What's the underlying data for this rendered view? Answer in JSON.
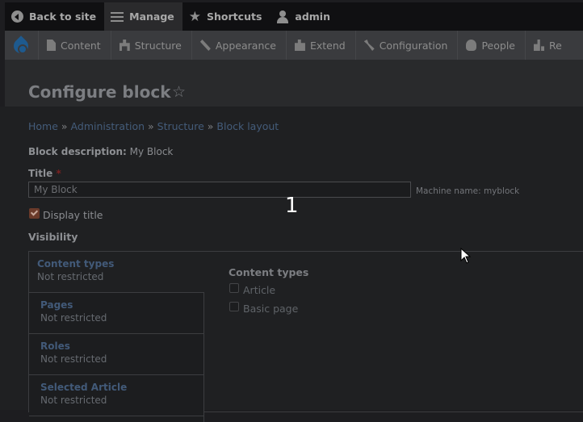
{
  "toolbar": {
    "back_label": "Back to site",
    "manage_label": "Manage",
    "shortcuts_label": "Shortcuts",
    "user_label": "admin"
  },
  "tray": {
    "items": [
      {
        "label": "Content",
        "icon": "content-icon"
      },
      {
        "label": "Structure",
        "icon": "structure-icon"
      },
      {
        "label": "Appearance",
        "icon": "appearance-icon"
      },
      {
        "label": "Extend",
        "icon": "extend-icon"
      },
      {
        "label": "Configuration",
        "icon": "configuration-icon"
      },
      {
        "label": "People",
        "icon": "people-icon"
      },
      {
        "label": "Re",
        "icon": "reports-icon"
      }
    ]
  },
  "page": {
    "title": "Configure block",
    "breadcrumb": [
      "Home",
      "Administration",
      "Structure",
      "Block layout"
    ],
    "breadcrumb_sep": "»"
  },
  "form": {
    "description_label": "Block description:",
    "description_value": "My Block",
    "title_label": "Title",
    "required_mark": "*",
    "title_value": "My Block",
    "machine_name": "Machine name: myblock",
    "display_title_label": "Display title",
    "display_title_checked": true,
    "visibility_label": "Visibility"
  },
  "visibility_tabs": [
    {
      "title": "Content types",
      "summary": "Not restricted"
    },
    {
      "title": "Pages",
      "summary": "Not restricted"
    },
    {
      "title": "Roles",
      "summary": "Not restricted"
    },
    {
      "title": "Selected Article",
      "summary": "Not restricted"
    }
  ],
  "pane": {
    "title": "Content types",
    "options": [
      "Article",
      "Basic page"
    ]
  },
  "overlay_label": "1",
  "colors": {
    "link": "#445c7a",
    "toolbar_bg": "#101012",
    "tray_bg": "#3a3b3e",
    "required": "#7a2121"
  }
}
